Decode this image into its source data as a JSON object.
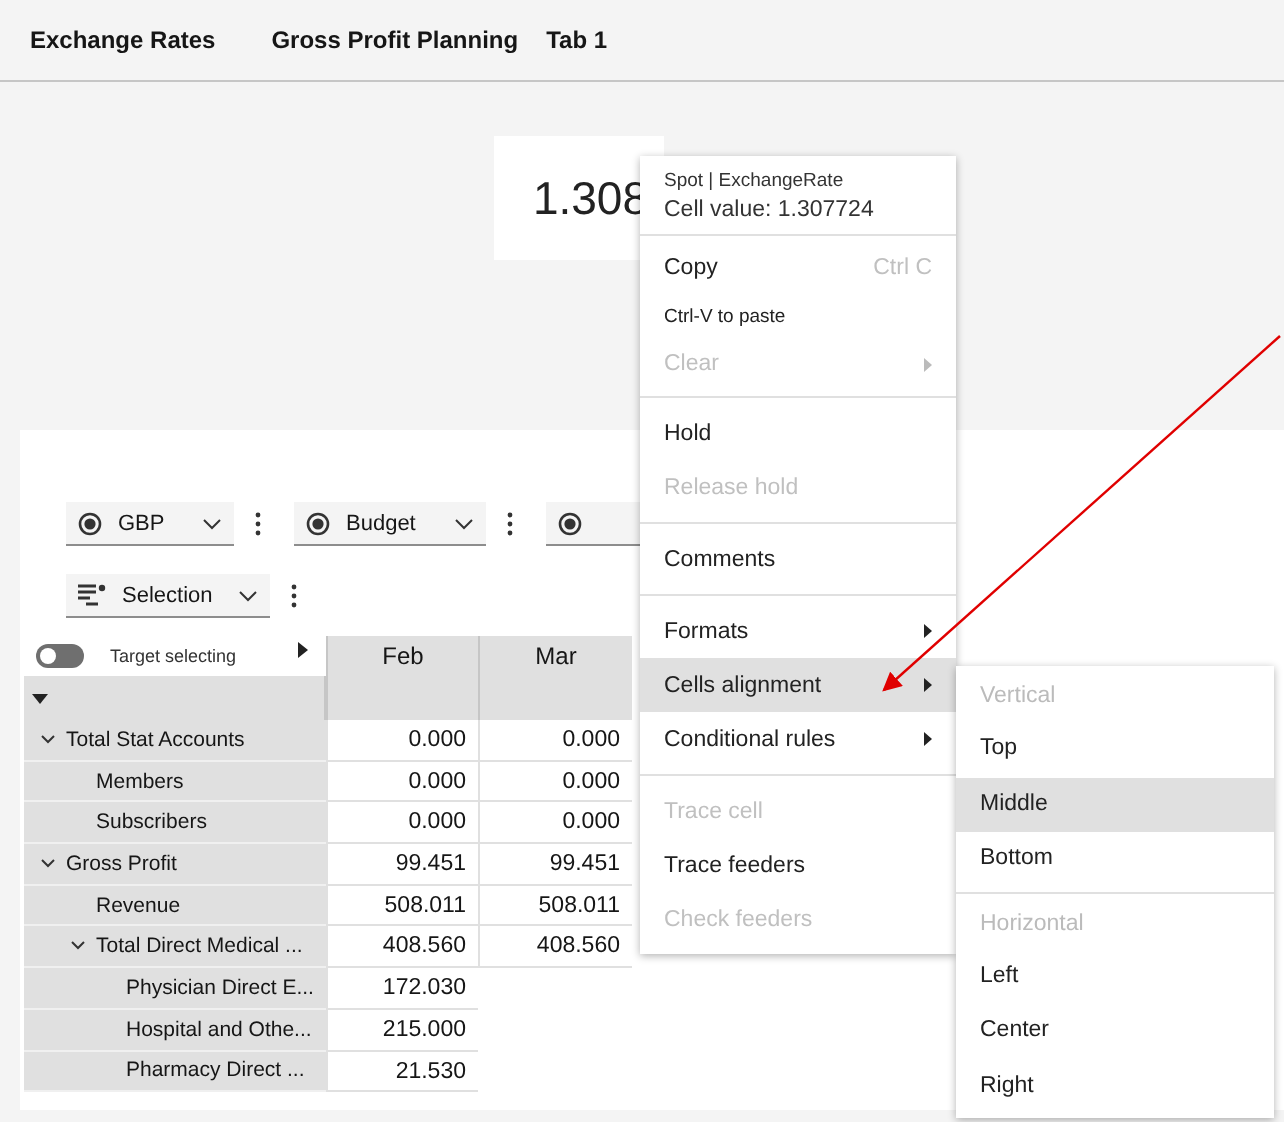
{
  "tabs": [
    {
      "label": "Exchange Rates"
    },
    {
      "label": "Gross Profit Planning"
    },
    {
      "label": "Tab 1"
    }
  ],
  "big_value": "1.308",
  "filters": [
    {
      "label": "GBP"
    },
    {
      "label": "Budget"
    }
  ],
  "selection_filter": {
    "label": "Selection"
  },
  "toggle": {
    "label": "Target selecting",
    "on": false
  },
  "columns": [
    "Feb",
    "Mar"
  ],
  "rows": [
    {
      "label": "Total Stat Accounts",
      "expanded": true,
      "values": [
        "0.000",
        "0.000"
      ],
      "children": [
        {
          "label": "Members",
          "values": [
            "0.000",
            "0.000"
          ]
        },
        {
          "label": "Subscribers",
          "values": [
            "0.000",
            "0.000"
          ]
        }
      ]
    },
    {
      "label": "Gross Profit",
      "expanded": true,
      "values": [
        "99.451",
        "99.451"
      ],
      "children": [
        {
          "label": "Revenue",
          "values": [
            "508.011",
            "508.011"
          ]
        },
        {
          "label": "Total Direct Medical ...",
          "expanded": true,
          "values": [
            "408.560",
            "408.560"
          ],
          "children": [
            {
              "label": "Physician Direct E...",
              "values": [
                "172.030"
              ]
            },
            {
              "label": "Hospital and Othe...",
              "values": [
                "215.000"
              ]
            },
            {
              "label": "Pharmacy Direct ...",
              "values": [
                "21.530"
              ]
            }
          ]
        }
      ]
    }
  ],
  "context_menu": {
    "title": "Spot | ExchangeRate",
    "cell_value": "Cell value:  1.307724",
    "groups": [
      [
        {
          "label": "Copy",
          "shortcut": "Ctrl C",
          "disabled": false,
          "selected": false
        },
        {
          "label": "Ctrl-V to paste",
          "kind": "hint",
          "disabled": false,
          "selected": false
        },
        {
          "label": "Clear",
          "disabled": true,
          "submenu": true,
          "selected": false
        }
      ],
      [
        {
          "label": "Hold",
          "disabled": false,
          "selected": false
        },
        {
          "label": "Release hold",
          "disabled": true,
          "selected": false
        }
      ],
      [
        {
          "label": "Comments",
          "disabled": false,
          "selected": false
        }
      ],
      [
        {
          "label": "Formats",
          "disabled": false,
          "submenu": true,
          "selected": false
        },
        {
          "label": "Cells alignment",
          "disabled": false,
          "submenu": true,
          "selected": true
        },
        {
          "label": "Conditional rules",
          "disabled": false,
          "submenu": true,
          "selected": false
        }
      ],
      [
        {
          "label": "Trace cell",
          "disabled": true,
          "selected": false
        },
        {
          "label": "Trace feeders",
          "disabled": false,
          "selected": false
        },
        {
          "label": "Check feeders",
          "disabled": true,
          "selected": false
        }
      ]
    ]
  },
  "submenu": {
    "groups": [
      {
        "heading": "Vertical",
        "items": [
          {
            "label": "Top",
            "selected": false
          },
          {
            "label": "Middle",
            "selected": true
          },
          {
            "label": "Bottom",
            "selected": false
          }
        ]
      },
      {
        "heading": "Horizontal",
        "items": [
          {
            "label": "Left",
            "selected": false
          },
          {
            "label": "Center",
            "selected": false
          },
          {
            "label": "Right",
            "selected": false
          }
        ]
      }
    ]
  }
}
